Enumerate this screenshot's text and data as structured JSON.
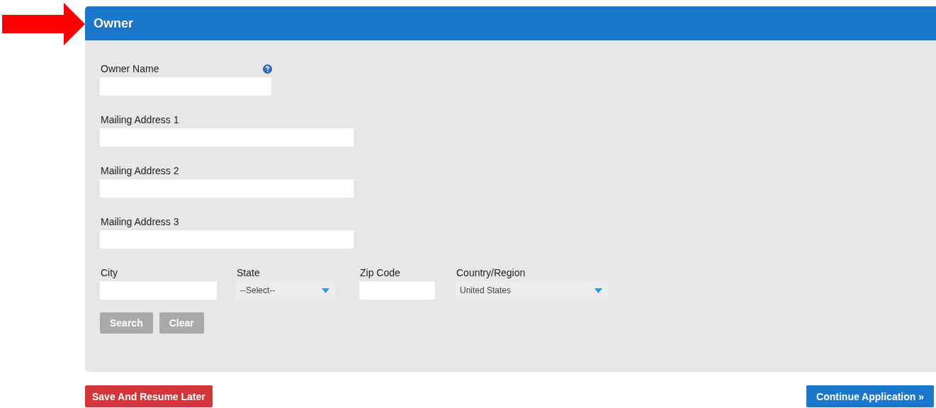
{
  "panel": {
    "title": "Owner"
  },
  "rows": [
    [
      {
        "label": "Owner Name",
        "kind": "text",
        "help": true
      }
    ],
    [
      {
        "label": "Mailing Address 1",
        "kind": "text",
        "help": false
      }
    ],
    [
      {
        "label": "Mailing Address 2",
        "kind": "text",
        "help": false
      }
    ],
    [
      {
        "label": "Mailing Address 3",
        "kind": "text",
        "help": false
      }
    ],
    [
      {
        "label": "City",
        "kind": "text",
        "help": false
      },
      {
        "label": "State",
        "kind": "select",
        "value": "--Select--",
        "help": false
      },
      {
        "label": "Zip Code",
        "kind": "text",
        "help": false
      },
      {
        "label": "Country/Region",
        "kind": "select",
        "value": "United States",
        "help": false
      }
    ]
  ],
  "form_buttons": [
    {
      "label": "Search",
      "disabled": true
    },
    {
      "label": "Clear",
      "disabled": true
    }
  ],
  "footer_buttons": [
    {
      "label": "Save And Resume Later",
      "kind": "danger"
    },
    {
      "label": "Continue Application »",
      "kind": "primary"
    }
  ]
}
